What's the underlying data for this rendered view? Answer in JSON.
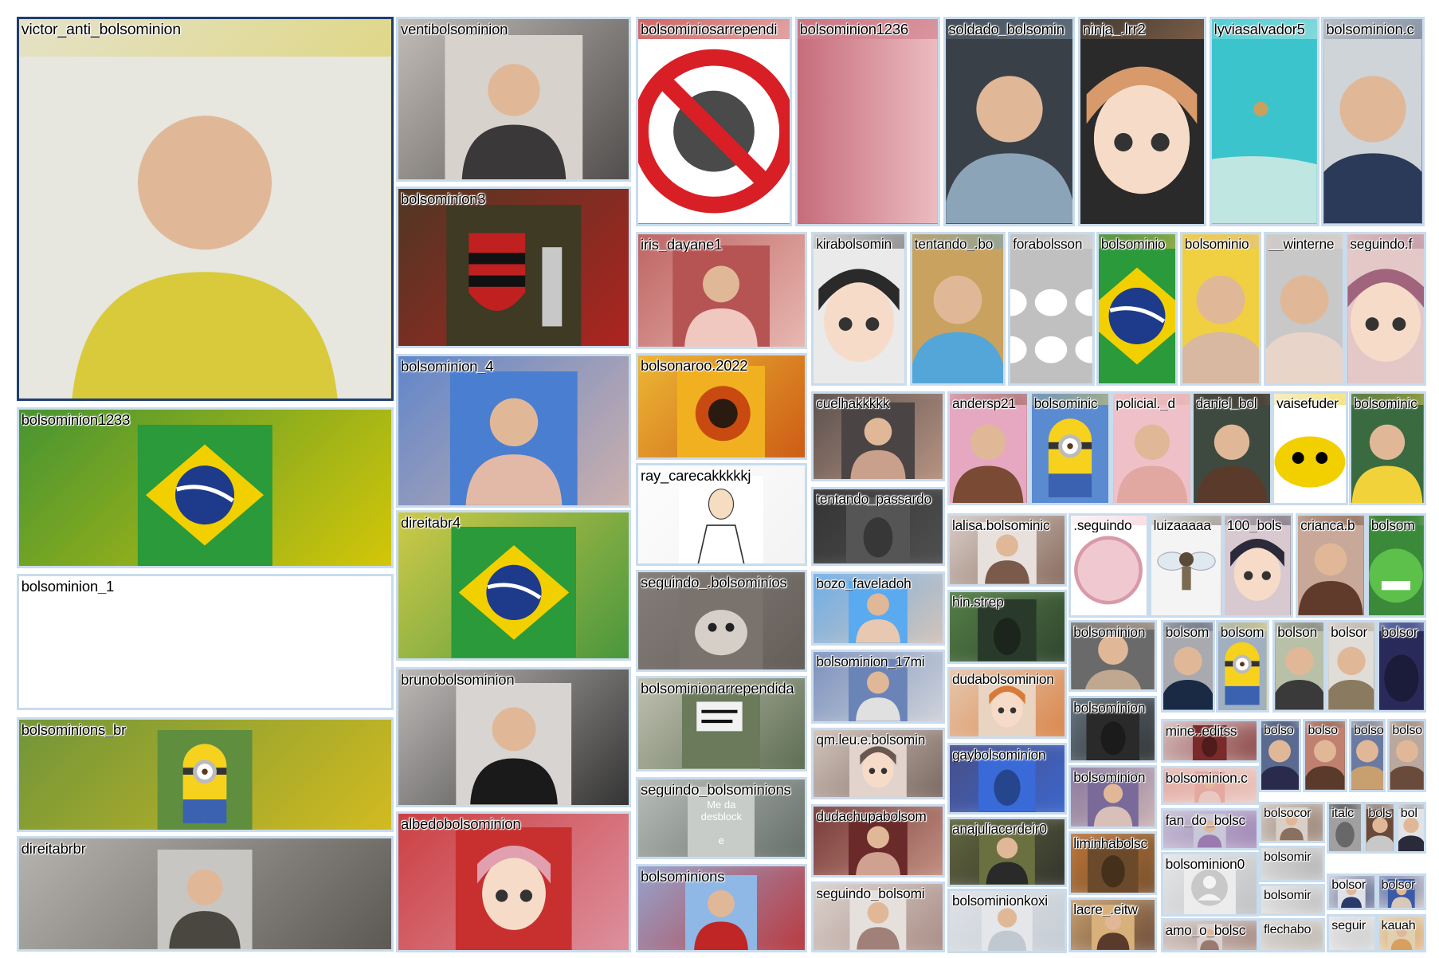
{
  "tiles": [
    {
      "name": "victor_anti_bolsominion",
      "c1": "#e7e6df",
      "c2": "#d8ca3a",
      "icon": "person",
      "selected": true
    },
    {
      "name": "bolsominion1233",
      "c1": "#2a8a3a",
      "c2": "#f0d000",
      "icon": "flag-br"
    },
    {
      "name": "bolsominion_1",
      "c1": "#ffffff",
      "c2": "#ffffff",
      "icon": "none"
    },
    {
      "name": "bolsominions_br",
      "c1": "#5e8e3e",
      "c2": "#e5c21b",
      "icon": "minion"
    },
    {
      "name": "direitabrbr",
      "c1": "#c8c6c2",
      "c2": "#4a4640",
      "icon": "person"
    },
    {
      "name": "ventibolsominion",
      "c1": "#d8d2cc",
      "c2": "#3a3838",
      "icon": "person"
    },
    {
      "name": "bolsominion3",
      "c1": "#3e3a24",
      "c2": "#c02020",
      "icon": "crest"
    },
    {
      "name": "bolsominion_4",
      "c1": "#4a7ed0",
      "c2": "#e2b8a6",
      "icon": "person"
    },
    {
      "name": "direitabr4",
      "c1": "#e8d44a",
      "c2": "#2f8c3b",
      "icon": "flag-br"
    },
    {
      "name": "brunobolsominion",
      "c1": "#d8d4d2",
      "c2": "#1a1a1a",
      "icon": "person"
    },
    {
      "name": "albedobolsominion",
      "c1": "#c83030",
      "c2": "#e0a0b0",
      "icon": "anime"
    },
    {
      "name": "bolsominiosarrependi",
      "c1": "#c74b4b",
      "c2": "#ffffff",
      "icon": "ban"
    },
    {
      "name": "iris_dayane1",
      "c1": "#b65454",
      "c2": "#f0c8c0",
      "icon": "person"
    },
    {
      "name": "bolsonaroo.2022",
      "c1": "#f2c93a",
      "c2": "#c74a10",
      "icon": "lion"
    },
    {
      "name": "ray_carecakkkkkj",
      "c1": "#ffffff",
      "c2": "#f1f1f1",
      "icon": "sketch"
    },
    {
      "name": "seguindo_.bolsominios",
      "c1": "#8a8380",
      "c2": "#5e5852",
      "icon": "cat"
    },
    {
      "name": "bolsominionarrependida",
      "c1": "#d4d0c4",
      "c2": "#4a5e40",
      "icon": "sign"
    },
    {
      "name": "seguindo_bolsominions",
      "c1": "#c8ccc8",
      "c2": "#56605a",
      "icon": "text",
      "caption": "Me da desblock\n\ne"
    },
    {
      "name": "bolsominions",
      "c1": "#8fb8e6",
      "c2": "#c02626",
      "icon": "person"
    },
    {
      "name": "bolsominion1236",
      "c1": "#c56673",
      "c2": "#f0cbd0",
      "icon": "gradient"
    },
    {
      "name": "kirabolsomin",
      "c1": "#eaeaea",
      "c2": "#2a2a2a",
      "icon": "anime"
    },
    {
      "name": "cuelhakkkkk",
      "c1": "#4a4444",
      "c2": "#c9a08c",
      "icon": "person"
    },
    {
      "name": "tentando_passardo",
      "c1": "#2e2e2e",
      "c2": "#555555",
      "icon": "dark"
    },
    {
      "name": "bozo_faveladoh",
      "c1": "#5aaaf0",
      "c2": "#e8c8b0",
      "icon": "person"
    },
    {
      "name": "bolsominion_17mi",
      "c1": "#6a84b8",
      "c2": "#e0e0e0",
      "icon": "person"
    },
    {
      "name": "qm.leu.e.bolsomin",
      "c1": "#e2d4cc",
      "c2": "#6a5850",
      "icon": "anime"
    },
    {
      "name": "dudachupabolsom",
      "c1": "#6a2a2a",
      "c2": "#d0a090",
      "icon": "person"
    },
    {
      "name": "seguindo_bolsomi",
      "c1": "#e6e0dc",
      "c2": "#a08078",
      "icon": "person"
    },
    {
      "name": "tentando_.bo",
      "c1": "#c8a25e",
      "c2": "#54a6d8",
      "icon": "person"
    },
    {
      "name": "soldado_bolsomin",
      "c1": "#3a4048",
      "c2": "#8ca4b8",
      "icon": "person"
    },
    {
      "name": "ninja_.lrr2",
      "c1": "#2a2a2a",
      "c2": "#d89a6a",
      "icon": "anime"
    },
    {
      "name": "lyviasalvador5",
      "c1": "#36c8d0",
      "c2": "#e8f0e8",
      "icon": "sea"
    },
    {
      "name": "bolsominion.c",
      "c1": "#cfd4d8",
      "c2": "#2a3a58",
      "icon": "person"
    },
    {
      "name": "forabolsson",
      "c1": "#b8b8b8",
      "c2": "#f0f0f0",
      "icon": "dogs"
    },
    {
      "name": "bolsominio",
      "c1": "#3a8a4a",
      "c2": "#f2d23a",
      "icon": "flag-br"
    },
    {
      "name": "bolsominio",
      "c1": "#f0d040",
      "c2": "#d8b8a0",
      "icon": "person"
    },
    {
      "name": "__winterne",
      "c1": "#c8c8c8",
      "c2": "#e8d4c8",
      "icon": "person"
    },
    {
      "name": "seguindo.f",
      "c1": "#e4c8c8",
      "c2": "#a0647c",
      "icon": "anime"
    },
    {
      "name": "andersp21",
      "c1": "#e6a8c0",
      "c2": "#7a4a34",
      "icon": "person"
    },
    {
      "name": "bolsominic",
      "c1": "#5a8ad0",
      "c2": "#f2d23a",
      "icon": "minion"
    },
    {
      "name": "policial._d",
      "c1": "#f0c0c8",
      "c2": "#e0a8a0",
      "icon": "person"
    },
    {
      "name": "daniel_bol",
      "c1": "#3e4a40",
      "c2": "#5a3a2a",
      "icon": "person"
    },
    {
      "name": "vaisefuder",
      "c1": "#f6f2e6",
      "c2": "#f0d000",
      "icon": "emoji"
    },
    {
      "name": "bolsominic",
      "c1": "#3a6a40",
      "c2": "#f2d23a",
      "icon": "person"
    },
    {
      "name": "lalisa.bolsominic",
      "c1": "#e8e0dc",
      "c2": "#7a5a4a",
      "icon": "person"
    },
    {
      "name": ".seguindo",
      "c1": "#ffffff",
      "c2": "#f0b8c0",
      "icon": "circle"
    },
    {
      "name": "luizaaaaa",
      "c1": "#f0f0f0",
      "c2": "#5a5040",
      "icon": "fairy"
    },
    {
      "name": "100_bols",
      "c1": "#d8c8d0",
      "c2": "#2a2a3a",
      "icon": "anime"
    },
    {
      "name": "crianca.b",
      "c1": "#c8a898",
      "c2": "#603a2a",
      "icon": "person"
    },
    {
      "name": "bolsom",
      "c1": "#4a7a3a",
      "c2": "#2a9a3a",
      "icon": "monster"
    },
    {
      "name": "hin.strep",
      "c1": "#5a8a4a",
      "c2": "#2a3a2a",
      "icon": "dark"
    },
    {
      "name": "dudabolsominion",
      "c1": "#e8d4c0",
      "c2": "#d87a3a",
      "icon": "anime"
    },
    {
      "name": "gaybolsominion",
      "c1": "#4a4a7a",
      "c2": "#3a6ad8",
      "icon": "dark"
    },
    {
      "name": "anajuliacerdeir0",
      "c1": "#6a7040",
      "c2": "#2a2a2a",
      "icon": "person"
    },
    {
      "name": "bolsominionkoxi",
      "c1": "#e4e6ea",
      "c2": "#c0c8d0",
      "icon": "person"
    },
    {
      "name": "bolsominion",
      "c1": "#6a6a6a",
      "c2": "#c0a890",
      "icon": "person"
    },
    {
      "name": "bolsom",
      "c1": "#a8aab0",
      "c2": "#1a2a44",
      "icon": "person"
    },
    {
      "name": "bolsom",
      "c1": "#a0b0c0",
      "c2": "#f2d23a",
      "icon": "minion"
    },
    {
      "name": "bolson",
      "c1": "#b8c0a8",
      "c2": "#3a3a3a",
      "icon": "person"
    },
    {
      "name": "bolsor",
      "c1": "#e0dcd8",
      "c2": "#8a7a60",
      "icon": "person"
    },
    {
      "name": "bolsor",
      "c1": "#5a6aa8",
      "c2": "#2a2a5a",
      "icon": "dark"
    },
    {
      "name": "bolsominion",
      "c1": "#6a7a88",
      "c2": "#2a2a2a",
      "icon": "dark"
    },
    {
      "name": "bolsominion",
      "c1": "#7a6a9a",
      "c2": "#d8c0b8",
      "icon": "person"
    },
    {
      "name": "liminhabolsc",
      "c1": "#c87a3a",
      "c2": "#6a4a2a",
      "icon": "dark"
    },
    {
      "name": "lacre_.eitw",
      "c1": "#d8b07a",
      "c2": "#5a3a2a",
      "icon": "person"
    },
    {
      "name": "mine..editss",
      "c1": "#e8d8d8",
      "c2": "#7a2a2a",
      "icon": "dark"
    },
    {
      "name": "bolsominion.c",
      "c1": "#e4a8a0",
      "c2": "#e8c8c0",
      "icon": "person"
    },
    {
      "name": "fan_do_bolsc",
      "c1": "#c8c8d8",
      "c2": "#9a7ab0",
      "icon": "person"
    },
    {
      "name": "bolsominion0",
      "c1": "#eceeef",
      "c2": "#b8babd",
      "icon": "avatar"
    },
    {
      "name": "amo_o_bolsc",
      "c1": "#d8d0cc",
      "c2": "#9a7a70",
      "icon": "person"
    },
    {
      "name": "bolso",
      "c1": "#5a6a90",
      "c2": "#2a2a4a",
      "icon": "person"
    },
    {
      "name": "bolso",
      "c1": "#c08070",
      "c2": "#5a3a2a",
      "icon": "person"
    },
    {
      "name": "bolso",
      "c1": "#6a7aa0",
      "c2": "#c8a070",
      "icon": "person"
    },
    {
      "name": "bolso",
      "c1": "#b8a8a0",
      "c2": "#6a4a3a",
      "icon": "person"
    },
    {
      "name": "bolsocor",
      "c1": "#d8d0c8",
      "c2": "#8a7060",
      "icon": "person"
    },
    {
      "name": "italc",
      "c1": "#2a2a2a",
      "c2": "#a0a0a0",
      "icon": "dark"
    },
    {
      "name": "bols",
      "c1": "#6a4a3a",
      "c2": "#c8c8c8",
      "icon": "person"
    },
    {
      "name": "bol",
      "c1": "#e0e4e8",
      "c2": "#2a2a3a",
      "icon": "person"
    },
    {
      "name": "bolsomir",
      "c1": "#e0e0e0",
      "c2": "#a8a8a8",
      "icon": "none"
    },
    {
      "name": "bolsomir",
      "c1": "#e8e8e8",
      "c2": "#b0b0b0",
      "icon": "none"
    },
    {
      "name": "flechabo",
      "c1": "#d8d4d0",
      "c2": "#b8b0a8",
      "icon": "none"
    },
    {
      "name": "bolsor",
      "c1": "#e0e0e8",
      "c2": "#2a3a6a",
      "icon": "person"
    },
    {
      "name": "bolsor",
      "c1": "#3a5aa8",
      "c2": "#d8c8b8",
      "icon": "person"
    },
    {
      "name": "seguir",
      "c1": "#e4e4e4",
      "c2": "#c8c8c8",
      "icon": "none"
    },
    {
      "name": "kauah",
      "c1": "#e0d0b0",
      "c2": "#d8a060",
      "icon": "person"
    }
  ]
}
